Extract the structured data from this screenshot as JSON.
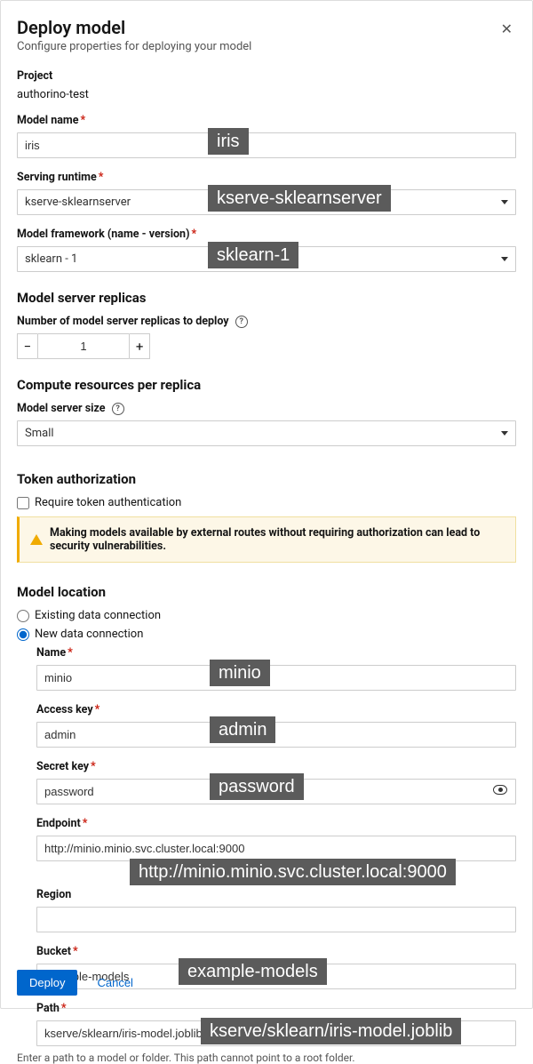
{
  "modal": {
    "title": "Deploy model",
    "subtitle": "Configure properties for deploying your model"
  },
  "project": {
    "label": "Project",
    "value": "authorino-test"
  },
  "model_name": {
    "label": "Model name",
    "value": "iris"
  },
  "serving_runtime": {
    "label": "Serving runtime",
    "value": "kserve-sklearnserver"
  },
  "model_framework": {
    "label": "Model framework (name - version)",
    "value": "sklearn - 1"
  },
  "replicas": {
    "section_title": "Model server replicas",
    "label": "Number of model server replicas to deploy",
    "value": "1"
  },
  "compute": {
    "section_title": "Compute resources per replica",
    "label": "Model server size",
    "value": "Small"
  },
  "token": {
    "section_title": "Token authorization",
    "checkbox_label": "Require token authentication",
    "warning": "Making models available by external routes without requiring authorization can lead to security vulnerabilities."
  },
  "location": {
    "section_title": "Model location",
    "radio_existing": "Existing data connection",
    "radio_new": "New data connection",
    "fields": {
      "name": {
        "label": "Name",
        "value": "minio"
      },
      "access_key": {
        "label": "Access key",
        "value": "admin"
      },
      "secret_key": {
        "label": "Secret key",
        "value": "password"
      },
      "endpoint": {
        "label": "Endpoint",
        "value": "http://minio.minio.svc.cluster.local:9000"
      },
      "region": {
        "label": "Region",
        "value": ""
      },
      "bucket": {
        "label": "Bucket",
        "value": "example-models"
      },
      "path": {
        "label": "Path",
        "value": "kserve/sklearn/iris-model.joblib",
        "help": "Enter a path to a model or folder. This path cannot point to a root folder."
      }
    }
  },
  "footer": {
    "deploy": "Deploy",
    "cancel": "Cancel"
  },
  "overlays": {
    "iris": "iris",
    "runtime": "kserve-sklearnserver",
    "framework": "sklearn-1",
    "minio": "minio",
    "admin": "admin",
    "password": "password",
    "endpoint": "http://minio.minio.svc.cluster.local:9000",
    "bucket": "example-models",
    "path": "kserve/sklearn/iris-model.joblib"
  }
}
